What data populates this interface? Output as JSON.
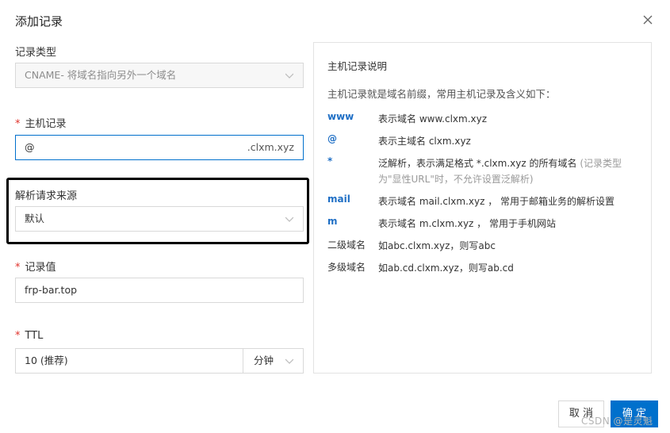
{
  "dialog": {
    "title": "添加记录"
  },
  "form": {
    "record_type": {
      "label": "记录类型",
      "value": "CNAME- 将域名指向另外一个域名"
    },
    "host": {
      "label": "主机记录",
      "value": "@",
      "suffix": ".clxm.xyz"
    },
    "source": {
      "label": "解析请求来源",
      "value": "默认"
    },
    "record_value": {
      "label": "记录值",
      "value": "frp-bar.top"
    },
    "ttl": {
      "label": "TTL",
      "value": "10 (推荐)",
      "unit": "分钟"
    }
  },
  "info": {
    "title": "主机记录说明",
    "desc": "主机记录就是域名前缀，常用主机记录及含义如下：",
    "rows": [
      {
        "key": "www",
        "val": "表示域名 www.clxm.xyz"
      },
      {
        "key": "@",
        "val": "表示主域名 clxm.xyz"
      },
      {
        "key": "*",
        "val": "泛解析，表示满足格式 *.clxm.xyz 的所有域名",
        "note": "(记录类型为\"显性URL\"时，不允许设置泛解析)"
      },
      {
        "key": "mail",
        "val": "表示域名 mail.clxm.xyz ， 常用于邮箱业务的解析设置"
      },
      {
        "key": "m",
        "val": "表示域名 m.clxm.xyz ， 常用于手机网站"
      },
      {
        "key": "二级域名",
        "val": "如abc.clxm.xyz，则写abc"
      },
      {
        "key": "多级域名",
        "val": "如ab.cd.clxm.xyz，则写ab.cd"
      }
    ]
  },
  "buttons": {
    "cancel": "取 消",
    "ok": "确 定"
  },
  "watermark": "CSDN @是灵魁",
  "colors": {
    "accent": "#0070cc",
    "required": "#e0322b",
    "key_blue": "#1f6fc5"
  }
}
